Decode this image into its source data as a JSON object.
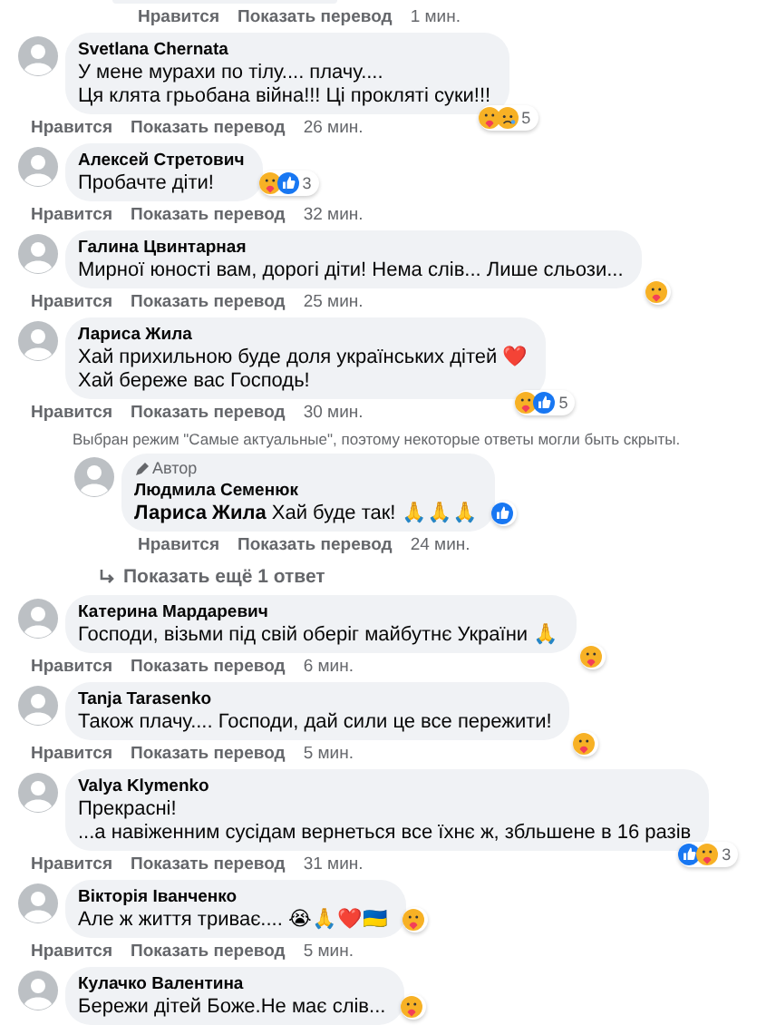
{
  "items": [
    {
      "kind": "tail",
      "actions": {
        "like": "Нравится",
        "translate": "Показать перевод",
        "time": "1 мин."
      }
    },
    {
      "kind": "comment",
      "author": "Svetlana Chernata",
      "lines": [
        "У мене мурахи по тілу.... плачу....",
        "Ця клята грьобана війна!!! Ці прокляті суки!!!"
      ],
      "actions": {
        "like": "Нравится",
        "translate": "Показать перевод",
        "time": "26 мин."
      },
      "reactions": {
        "kind": "corner",
        "icons": [
          {
            "kind": "care"
          },
          {
            "kind": "sad"
          }
        ],
        "count": "5"
      }
    },
    {
      "kind": "comment",
      "author": "Алексей Стретович",
      "lines": [
        "Пробачте діти!"
      ],
      "actions": {
        "like": "Нравится",
        "translate": "Показать перевод",
        "time": "32 мин."
      },
      "reactions": {
        "kind": "side",
        "icons": [
          {
            "kind": "care"
          },
          {
            "kind": "like"
          }
        ],
        "count": "3"
      }
    },
    {
      "kind": "comment",
      "author": "Галина Цвинтарная",
      "lines": [
        "Мирної юності вам, дорогі діти! Нема слів... Лише сльози..."
      ],
      "actions": {
        "like": "Нравится",
        "translate": "Показать перевод",
        "time": "25 мин."
      },
      "reactions": {
        "kind": "corner",
        "icons": [
          {
            "kind": "care"
          }
        ]
      }
    },
    {
      "kind": "comment",
      "author": "Лариса Жила",
      "lines": [
        "Хай прихильною буде доля українських дітей ❤️",
        "Хай береже вас Господь!"
      ],
      "actions": {
        "like": "Нравится",
        "translate": "Показать перевод",
        "time": "30 мин."
      },
      "reactions": {
        "kind": "corner",
        "icons": [
          {
            "kind": "care"
          },
          {
            "kind": "like"
          }
        ],
        "count": "5"
      }
    },
    {
      "kind": "notice",
      "text": "Выбран режим \"Самые актуальные\", поэтому некоторые ответы могли быть скрыты."
    },
    {
      "kind": "reply",
      "badge": "Автор",
      "author": "Людмила Семенюк",
      "lines": [
        "**Лариса Жила** Хай буде так! 🙏🙏🙏"
      ],
      "actions": {
        "like": "Нравится",
        "translate": "Показать перевод",
        "time": "24 мин."
      },
      "reactions": {
        "kind": "side",
        "icons": [
          {
            "kind": "like"
          }
        ]
      }
    },
    {
      "kind": "more",
      "text": "Показать ещё 1 ответ"
    },
    {
      "kind": "comment",
      "author": "Катерина Мардаревич",
      "lines": [
        "Господи, візьми під свій оберіг майбутнє України 🙏"
      ],
      "actions": {
        "like": "Нравится",
        "translate": "Показать перевод",
        "time": "6 мин."
      },
      "reactions": {
        "kind": "corner",
        "icons": [
          {
            "kind": "care"
          }
        ]
      }
    },
    {
      "kind": "comment",
      "author": "Tanja Tarasenko",
      "lines": [
        "Також плачу.... Господи, дай сили це все пережити!"
      ],
      "actions": {
        "like": "Нравится",
        "translate": "Показать перевод",
        "time": "5 мин."
      },
      "reactions": {
        "kind": "corner",
        "icons": [
          {
            "kind": "care"
          }
        ]
      }
    },
    {
      "kind": "comment",
      "author": "Valya Klymenko",
      "lines": [
        "Прекрасні!",
        "...а навіженним сусідам вернеться все їхнє ж, збльшене в 16 разів"
      ],
      "actions": {
        "like": "Нравится",
        "translate": "Показать перевод",
        "time": "31 мин."
      },
      "reactions": {
        "kind": "corner",
        "icons": [
          {
            "kind": "like"
          },
          {
            "kind": "care"
          }
        ],
        "count": "3"
      }
    },
    {
      "kind": "comment",
      "author": "Вікторія Іванченко",
      "lines": [
        "Але ж життя триває.... 😭🙏❤️🇺🇦"
      ],
      "actions": {
        "like": "Нравится",
        "translate": "Показать перевод",
        "time": "5 мин."
      },
      "reactions": {
        "kind": "side",
        "icons": [
          {
            "kind": "care"
          }
        ]
      }
    },
    {
      "kind": "comment",
      "author": "Кулачко Валентина",
      "lines": [
        "Бережи дітей Боже.Не має слів..."
      ],
      "reactions": {
        "kind": "side",
        "icons": [
          {
            "kind": "care"
          }
        ]
      }
    }
  ]
}
